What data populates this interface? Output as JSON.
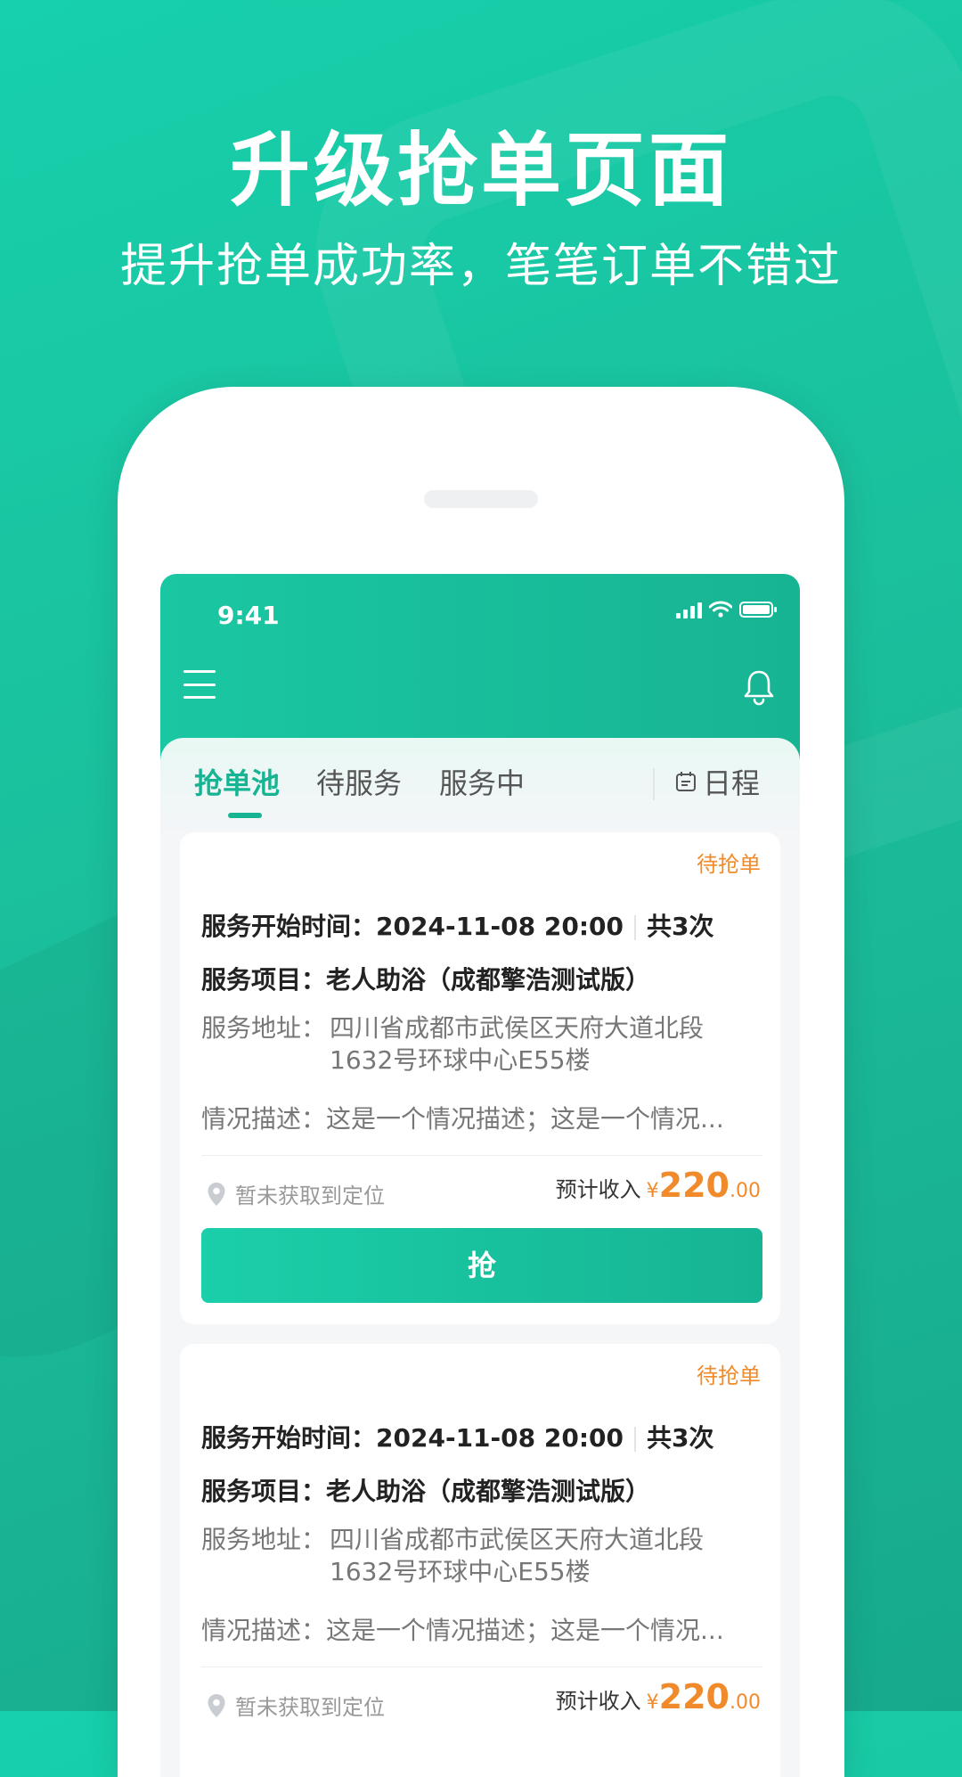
{
  "headline": "升级抢单页面",
  "subline": "提升抢单成功率，笔笔订单不错过",
  "status_bar": {
    "time": "9:41"
  },
  "tabs": [
    {
      "label": "抢单池"
    },
    {
      "label": "待服务"
    },
    {
      "label": "服务中"
    }
  ],
  "schedule_label": "日程",
  "cards": [
    {
      "status": "待抢单",
      "start_time_label": "服务开始时间：",
      "start_time": "2024-11-08 20:00",
      "count": "共3次",
      "project_label": "服务项目：",
      "project": "老人助浴（成都擎浩测试版）",
      "address_label": "服务地址：",
      "address": "四川省成都市武侯区天府大道北段1632号环球中心E55楼",
      "desc_label": "情况描述：",
      "desc": "这是一个情况描述；这是一个情况...",
      "location": "暂未获取到定位",
      "income_label": "预计收入",
      "currency": "¥",
      "income_int": "220",
      "income_dec": ".00",
      "button": "抢"
    },
    {
      "status": "待抢单",
      "start_time_label": "服务开始时间：",
      "start_time": "2024-11-08 20:00",
      "count": "共3次",
      "project_label": "服务项目：",
      "project": "老人助浴（成都擎浩测试版）",
      "address_label": "服务地址：",
      "address": "四川省成都市武侯区天府大道北段1632号环球中心E55楼",
      "desc_label": "情况描述：",
      "desc": "这是一个情况描述；这是一个情况...",
      "location": "暂未获取到定位",
      "income_label": "预计收入",
      "currency": "¥",
      "income_int": "220",
      "income_dec": ".00"
    }
  ],
  "colors": {
    "brand": "#17b493",
    "accent": "#f08a2a"
  },
  "icons": [
    "menu-icon",
    "bell-icon",
    "calendar-icon",
    "location-pin-icon",
    "signal-icon",
    "wifi-icon",
    "battery-icon"
  ]
}
